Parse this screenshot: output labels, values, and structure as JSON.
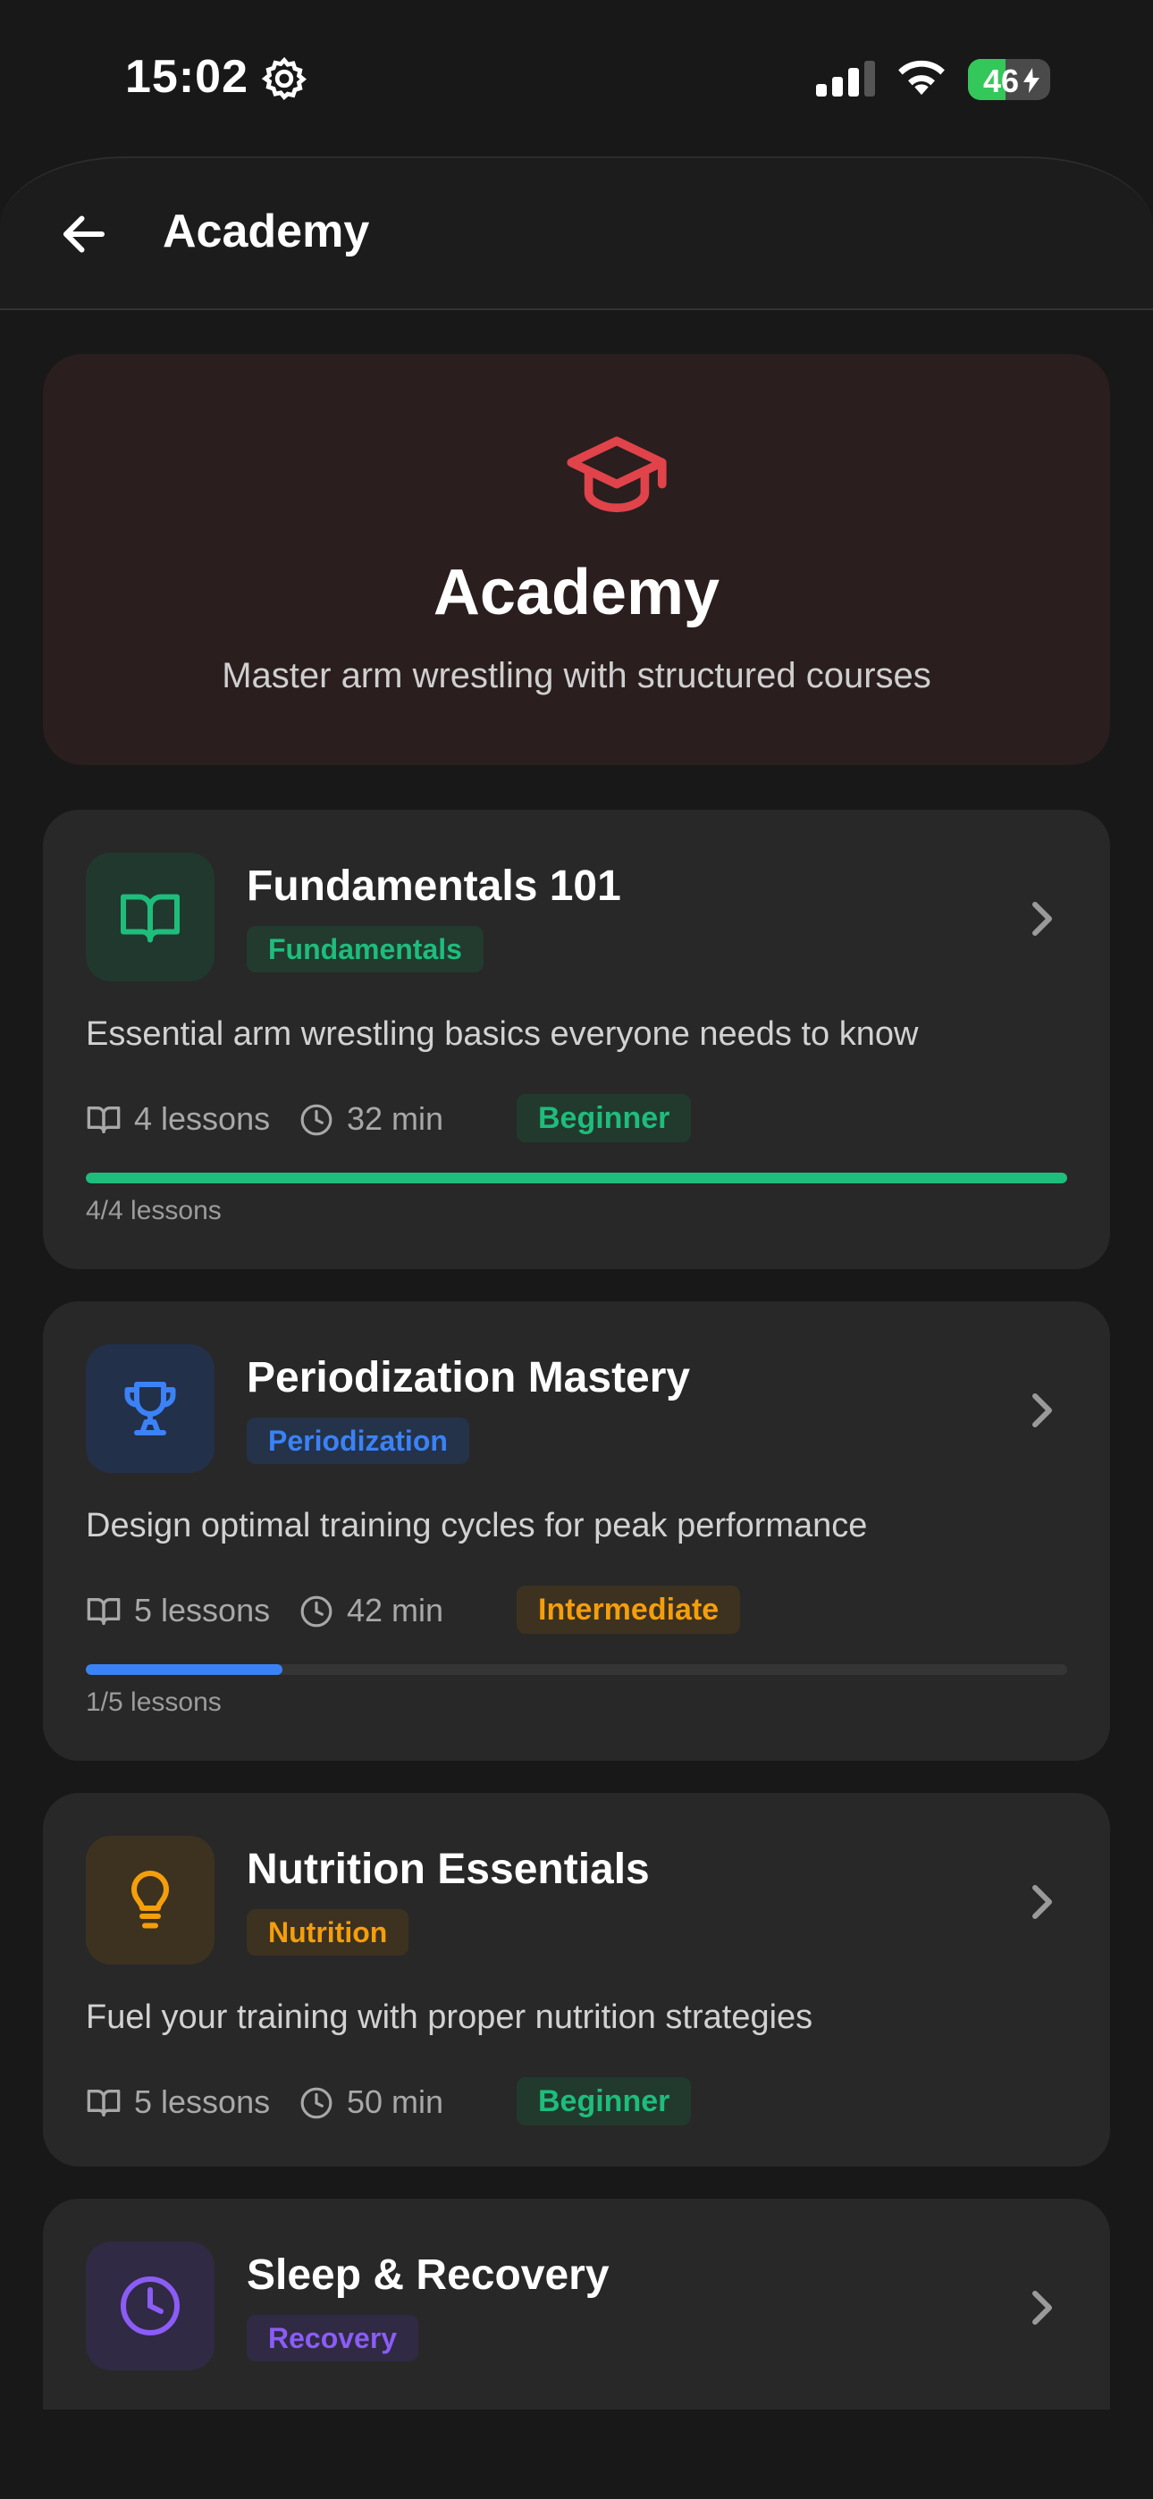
{
  "status_bar": {
    "time": "15:02",
    "battery": "46"
  },
  "nav": {
    "title": "Academy"
  },
  "hero": {
    "title": "Academy",
    "subtitle": "Master arm wrestling with structured courses",
    "icon": "graduation-cap-icon"
  },
  "colors": {
    "accent_red": "#e0434a",
    "green": "#1ebd7c",
    "blue": "#3b82f6",
    "orange": "#f59e0b",
    "purple": "#8b5cf6"
  },
  "courses": [
    {
      "title": "Fundamentals 101",
      "category": "Fundamentals",
      "description": "Essential arm wrestling basics everyone needs to know",
      "lessons": "4 lessons",
      "duration": "32 min",
      "level": "Beginner",
      "progress_label": "4/4 lessons",
      "progress": 1.0,
      "icon": "book-icon"
    },
    {
      "title": "Periodization Mastery",
      "category": "Periodization",
      "description": "Design optimal training cycles for peak performance",
      "lessons": "5 lessons",
      "duration": "42 min",
      "level": "Intermediate",
      "progress_label": "1/5 lessons",
      "progress": 0.2,
      "icon": "trophy-icon"
    },
    {
      "title": "Nutrition Essentials",
      "category": "Nutrition",
      "description": "Fuel your training with proper nutrition strategies",
      "lessons": "5 lessons",
      "duration": "50 min",
      "level": "Beginner",
      "icon": "lightbulb-icon"
    },
    {
      "title": "Sleep & Recovery",
      "category": "Recovery",
      "icon": "clock-icon"
    }
  ]
}
